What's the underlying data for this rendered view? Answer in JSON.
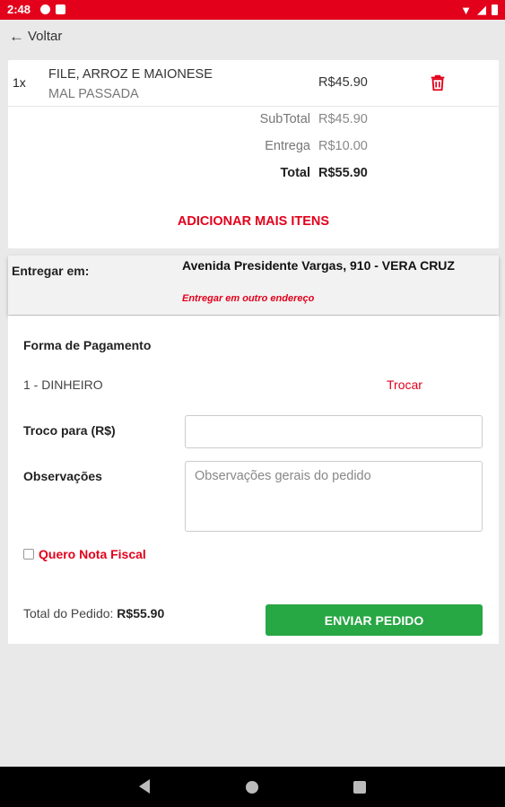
{
  "status_bar": {
    "time": "2:48"
  },
  "header": {
    "back_label": "Voltar"
  },
  "cart": {
    "items": [
      {
        "qty": "1x",
        "name_line1": "FILE, ARROZ E MAIONESE",
        "name_line2": "MAL PASSADA",
        "price": "R$45.90"
      }
    ],
    "subtotal_label": "SubTotal",
    "subtotal_value": "R$45.90",
    "delivery_label": "Entrega",
    "delivery_value": "R$10.00",
    "total_label": "Total",
    "total_value": "R$55.90",
    "add_more_label": "ADICIONAR MAIS ITENS"
  },
  "delivery": {
    "label": "Entregar em:",
    "address": "Avenida Presidente Vargas, 910 - VERA CRUZ",
    "other_address_link": "Entregar em outro endereço"
  },
  "payment": {
    "title": "Forma de Pagamento",
    "method": "1 - DINHEIRO",
    "change_link": "Trocar",
    "change_for_label": "Troco para (R$)",
    "change_for_value": "",
    "notes_label": "Observações",
    "notes_placeholder": "Observações gerais do pedido",
    "invoice_label": "Quero Nota Fiscal",
    "order_total_label": "Total do Pedido:",
    "order_total_value": "R$55.90",
    "submit_label": "ENVIAR PEDIDO"
  },
  "colors": {
    "accent": "#e3001b",
    "submit": "#28a745"
  }
}
